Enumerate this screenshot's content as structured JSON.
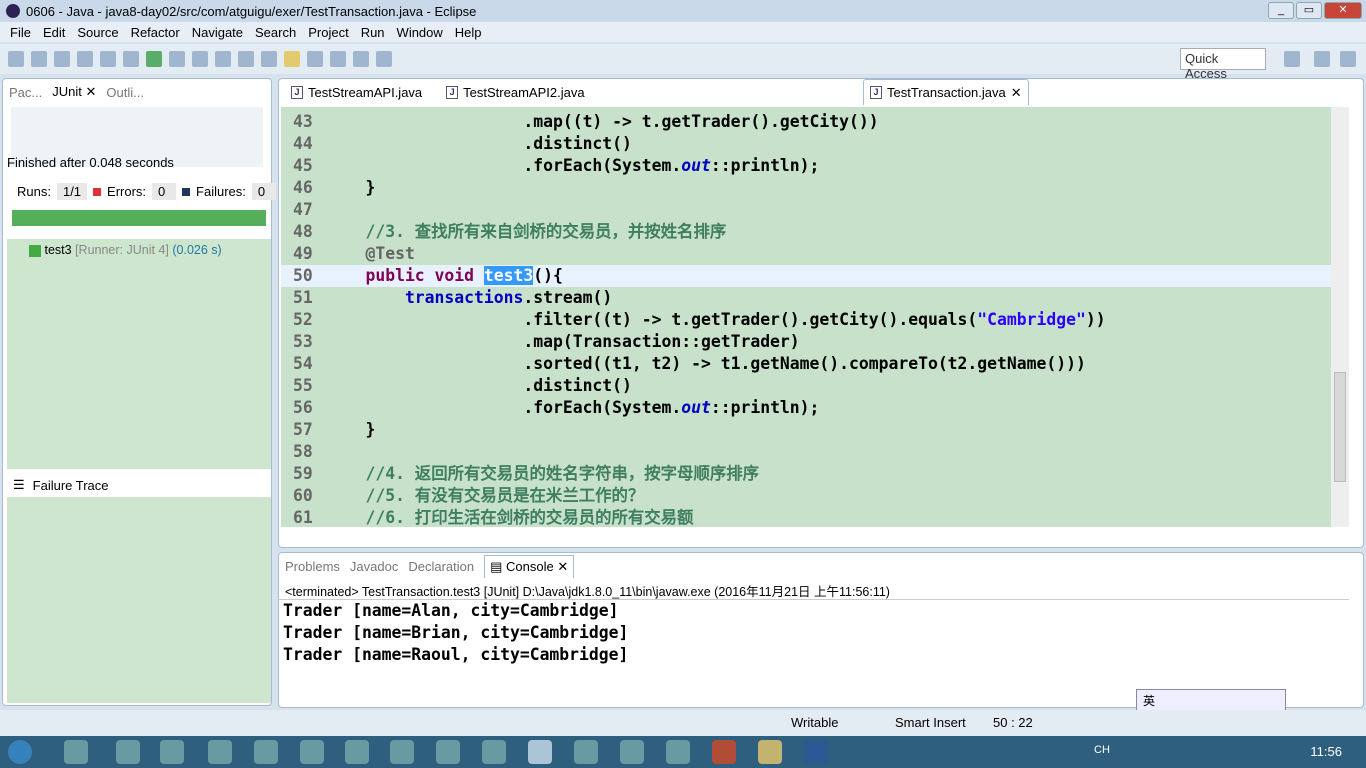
{
  "window": {
    "title": "0606 - Java - java8-day02/src/com/atguigu/exer/TestTransaction.java - Eclipse"
  },
  "menu": [
    "File",
    "Edit",
    "Source",
    "Refactor",
    "Navigate",
    "Search",
    "Project",
    "Run",
    "Window",
    "Help"
  ],
  "quick_access": "Quick Access",
  "left": {
    "tabs": [
      "Pac...",
      "JUnit",
      "Outli..."
    ],
    "finished": "Finished after 0.048 seconds",
    "runs_label": "Runs:",
    "runs": "1/1",
    "errors_label": "Errors:",
    "errors": "0",
    "failures_label": "Failures:",
    "failures": "0",
    "progress": 1.0,
    "progress_color": "#54ae5a",
    "test_name": "test3",
    "test_runner": "[Runner: JUnit 4]",
    "test_time": "(0.026 s)",
    "failure_trace": "Failure Trace"
  },
  "editor": {
    "tabs": [
      "TestStreamAPI.java",
      "TestStreamAPI2.java",
      "TestTransaction.java"
    ],
    "lines": [
      {
        "n": "43",
        "segs": [
          [
            "",
            "                    .map((t) -> t.getTrader().getCity())"
          ]
        ]
      },
      {
        "n": "44",
        "segs": [
          [
            "",
            "                    .distinct()"
          ]
        ]
      },
      {
        "n": "45",
        "segs": [
          [
            "",
            "                    .forEach(System."
          ],
          [
            "st",
            "out"
          ],
          [
            "",
            "::println);"
          ]
        ]
      },
      {
        "n": "46",
        "segs": [
          [
            "",
            "    }"
          ]
        ]
      },
      {
        "n": "47",
        "segs": [
          [
            "",
            ""
          ]
        ]
      },
      {
        "n": "48",
        "segs": [
          [
            "cm",
            "    //3. 查找所有来自剑桥的交易员，并按姓名排序"
          ]
        ]
      },
      {
        "n": "49",
        "segs": [
          [
            "an",
            "    @Test"
          ]
        ]
      },
      {
        "n": "50",
        "segs": [
          [
            "kw",
            "    public void "
          ],
          [
            "sel",
            "test3"
          ],
          [
            "",
            "(){"
          ]
        ],
        "current": true
      },
      {
        "n": "51",
        "segs": [
          [
            "fd",
            "        transactions"
          ],
          [
            "",
            ".stream()"
          ]
        ]
      },
      {
        "n": "52",
        "segs": [
          [
            "",
            "                    .filter((t) -> t.getTrader().getCity().equals("
          ],
          [
            "sr",
            "\"Cambridge\""
          ],
          [
            "",
            "))"
          ]
        ]
      },
      {
        "n": "53",
        "segs": [
          [
            "",
            "                    .map(Transaction::getTrader)"
          ]
        ]
      },
      {
        "n": "54",
        "segs": [
          [
            "",
            "                    .sorted((t1, t2) -> t1.getName().compareTo(t2.getName()))"
          ]
        ]
      },
      {
        "n": "55",
        "segs": [
          [
            "",
            "                    .distinct()"
          ]
        ]
      },
      {
        "n": "56",
        "segs": [
          [
            "",
            "                    .forEach(System."
          ],
          [
            "st",
            "out"
          ],
          [
            "",
            "::println);"
          ]
        ]
      },
      {
        "n": "57",
        "segs": [
          [
            "",
            "    }"
          ]
        ]
      },
      {
        "n": "58",
        "segs": [
          [
            "",
            ""
          ]
        ]
      },
      {
        "n": "59",
        "segs": [
          [
            "cm",
            "    //4. 返回所有交易员的姓名字符串，按字母顺序排序"
          ]
        ]
      },
      {
        "n": "60",
        "segs": [
          [
            "cm",
            "    //5. 有没有交易员是在米兰工作的？"
          ]
        ]
      },
      {
        "n": "61",
        "segs": [
          [
            "cm",
            "    //6. 打印生活在剑桥的交易员的所有交易额"
          ]
        ]
      }
    ]
  },
  "console": {
    "tabs": [
      "Problems",
      "Javadoc",
      "Declaration",
      "Console"
    ],
    "terminated": "<terminated> TestTransaction.test3 [JUnit] D:\\Java\\jdk1.8.0_11\\bin\\javaw.exe (2016年11月21日 上午11:56:11)",
    "output": [
      "Trader [name=Alan, city=Cambridge]",
      "Trader [name=Brian, city=Cambridge]",
      "Trader [name=Raoul, city=Cambridge]"
    ]
  },
  "ime": "英",
  "status": {
    "writable": "Writable",
    "insert": "Smart Insert",
    "position": "50 : 22"
  },
  "taskbar": {
    "lang": "CH",
    "clock": "11:56"
  }
}
